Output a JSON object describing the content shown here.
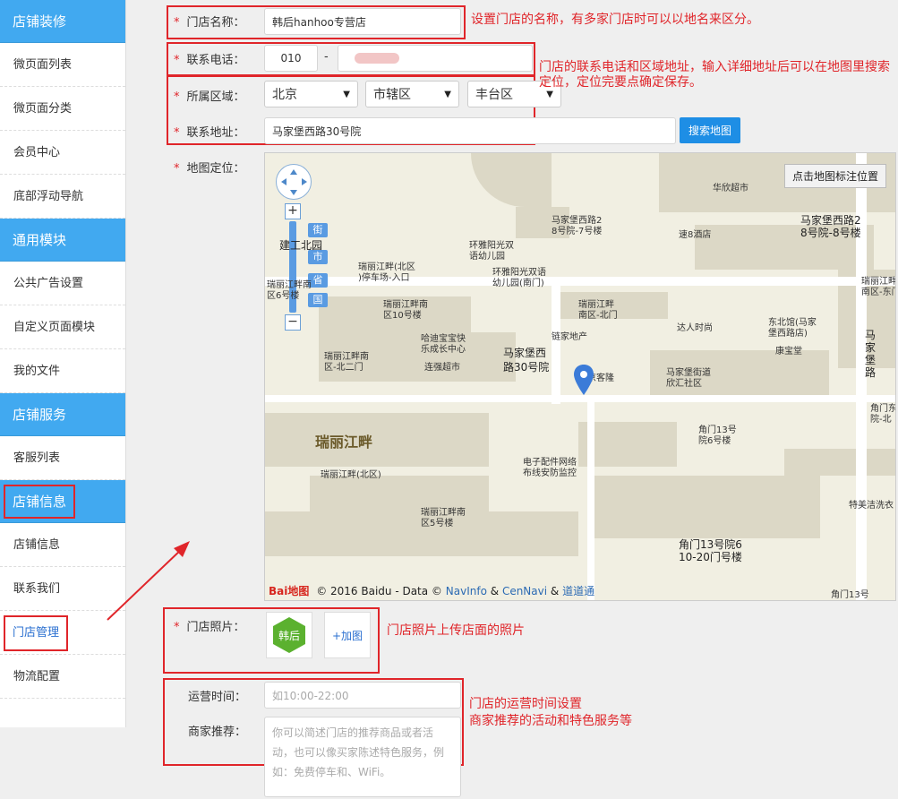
{
  "sidebar": {
    "sections": [
      {
        "title": "店铺装修",
        "items": [
          "微页面列表",
          "微页面分类",
          "会员中心",
          "底部浮动导航"
        ]
      },
      {
        "title": "通用模块",
        "items": [
          "公共广告设置",
          "自定义页面模块",
          "我的文件"
        ]
      },
      {
        "title": "店铺服务",
        "items": [
          "客服列表"
        ]
      },
      {
        "title": "店铺信息",
        "items": [
          "店铺信息",
          "联系我们",
          "门店管理",
          "物流配置"
        ]
      }
    ],
    "active_item": "门店管理"
  },
  "form": {
    "store_name_label": "门店名称：",
    "store_name_value": "韩后hanhoo专营店",
    "phone_label": "联系电话：",
    "phone_area": "010",
    "phone_sep": "-",
    "region_label": "所属区域：",
    "province": "北京",
    "city": "市辖区",
    "district": "丰台区",
    "address_label": "联系地址：",
    "address_value": "马家堡西路30号院",
    "search_map_button": "搜索地图",
    "map_label": "地图定位：",
    "photo_label": "门店照片：",
    "add_photo_button": "+加图",
    "logo_text": "韩后",
    "hours_label": "运营时间：",
    "hours_placeholder": "如10:00-22:00",
    "recommend_label": "商家推荐：",
    "recommend_placeholder": "你可以简述门店的推荐商品或者活动，也可以像买家陈述特色服务，例如：免费停车和、WiFi。"
  },
  "map": {
    "mark_button": "点击地图标注位置",
    "zoom_levels": [
      "街",
      "市",
      "省",
      "国"
    ],
    "labels": [
      "华欣超市",
      "马家堡西路2",
      "8号院-7号楼",
      "马家堡西路2",
      "8号院-8号楼",
      "速8酒店",
      "建工北园",
      "环雅阳光双",
      "语幼儿园",
      "瑞丽江畔(北区",
      ")停车场-入口",
      "环雅阳光双语",
      "幼儿园(南门)",
      "瑞丽江畔南",
      "区6号楼",
      "瑞丽江畔南",
      "区10号楼",
      "瑞丽江畔",
      "南区-北门",
      "达人时尚",
      "东北馆(马家",
      "堡西路店)",
      "康宝堂",
      "链家地产",
      "哈迪宝宝快",
      "乐成长中心",
      "马家堡西",
      "路30号院",
      "瑞丽江畔南",
      "区-北二门",
      "连强超市",
      "京客隆",
      "马家堡街道",
      "欣汇社区",
      "瑞丽江畔",
      "角门13号",
      "院6号楼",
      "电子配件网络",
      "布线安防监控",
      "瑞丽江畔(北区)",
      "瑞丽江畔南",
      "区5号楼",
      "角门13号院6",
      "10-20门号楼",
      "特美洁洗衣",
      "角门13号",
      "马家堡路",
      "瑞丽江畔",
      "南区-东门",
      "角门东",
      "院-北"
    ],
    "footer_copyright": "© 2016 Baidu - Data ©",
    "footer_navinfo": "NavInfo",
    "footer_amp1": "&",
    "footer_cennavi": "CenNavi",
    "footer_amp2": "&",
    "footer_daodao": "道道通",
    "baidu_logo": "Bai地图"
  },
  "notes": {
    "name": "设置门店的名称，有多家门店时可以以地名来区分。",
    "contact": "门店的联系电话和区域地址，输入详细地址后可以在地图里搜索定位，定位完要点确定保存。",
    "photo": "门店照片上传店面的照片",
    "hours_line1": "门店的运营时间设置",
    "hours_line2": "商家推荐的活动和特色服务等"
  }
}
